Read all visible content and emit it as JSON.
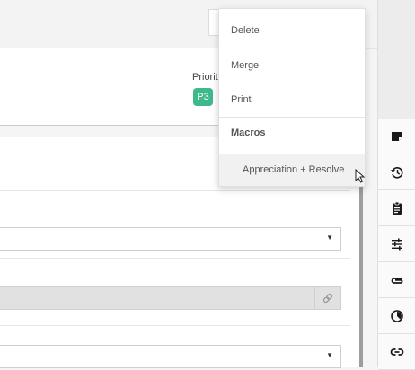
{
  "ticket_header": {
    "priority_label": "Priorit",
    "priority_value": "P3"
  },
  "colors": {
    "priority_badge": "#3fb88c",
    "menu_hover": "#f1f1f1"
  },
  "actions_menu": {
    "items": [
      "Delete",
      "Merge",
      "Print"
    ],
    "macros_heading": "Macros",
    "macros": [
      "Appreciation + Resolve"
    ]
  },
  "right_sidebar": {
    "icons": [
      "note-icon",
      "history-icon",
      "clipboard-icon",
      "sliders-icon",
      "paperclip-icon",
      "timer-icon",
      "link-icon"
    ]
  }
}
